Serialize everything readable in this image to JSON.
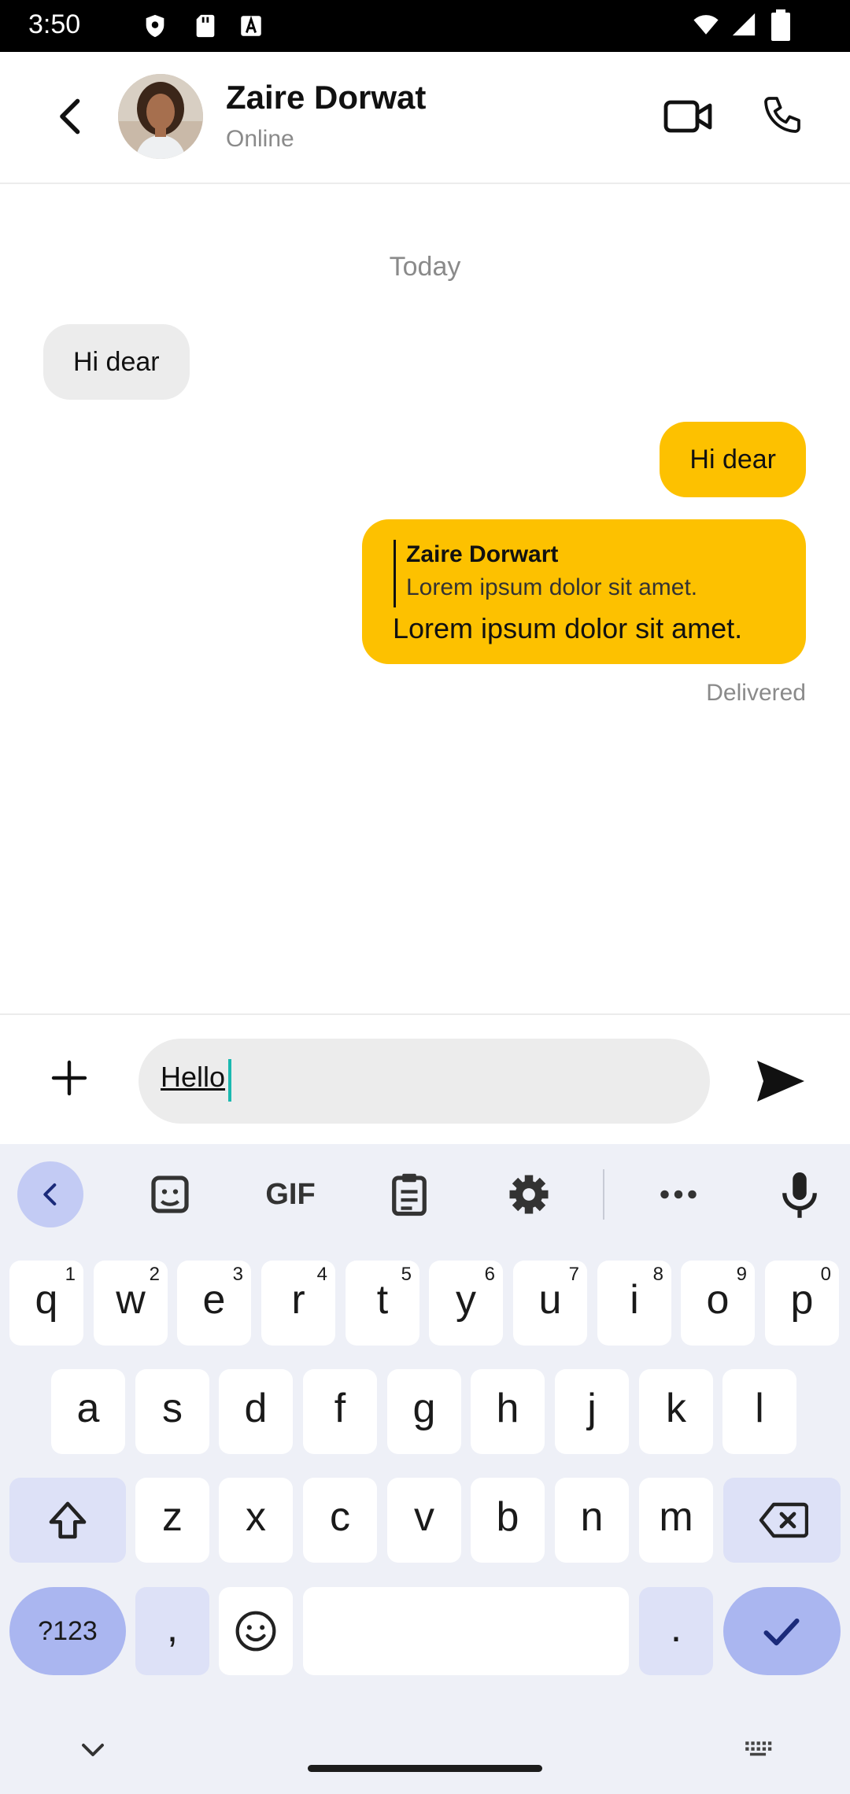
{
  "status_bar": {
    "time": "3:50"
  },
  "header": {
    "contact_name": "Zaire Dorwat",
    "contact_status": "Online"
  },
  "chat": {
    "day_label": "Today",
    "messages": [
      {
        "direction": "in",
        "text": "Hi dear"
      },
      {
        "direction": "out",
        "text": "Hi dear"
      },
      {
        "direction": "out",
        "quote_name": "Zaire Dorwart",
        "quote_text": "Lorem ipsum dolor sit amet.",
        "text": "Lorem ipsum dolor sit amet."
      }
    ],
    "delivery_status": "Delivered"
  },
  "composer": {
    "input_value": "Hello"
  },
  "keyboard": {
    "toolbar": {
      "gif": "GIF"
    },
    "row1": [
      {
        "k": "q",
        "h": "1"
      },
      {
        "k": "w",
        "h": "2"
      },
      {
        "k": "e",
        "h": "3"
      },
      {
        "k": "r",
        "h": "4"
      },
      {
        "k": "t",
        "h": "5"
      },
      {
        "k": "y",
        "h": "6"
      },
      {
        "k": "u",
        "h": "7"
      },
      {
        "k": "i",
        "h": "8"
      },
      {
        "k": "o",
        "h": "9"
      },
      {
        "k": "p",
        "h": "0"
      }
    ],
    "row2": [
      "a",
      "s",
      "d",
      "f",
      "g",
      "h",
      "j",
      "k",
      "l"
    ],
    "row3": [
      "z",
      "x",
      "c",
      "v",
      "b",
      "n",
      "m"
    ],
    "symbols_key": "?123",
    "comma_key": ",",
    "period_key": "."
  },
  "colors": {
    "accent": "#fdc100",
    "incoming_bubble": "#ececec",
    "keyboard_bg": "#eef0f7"
  }
}
